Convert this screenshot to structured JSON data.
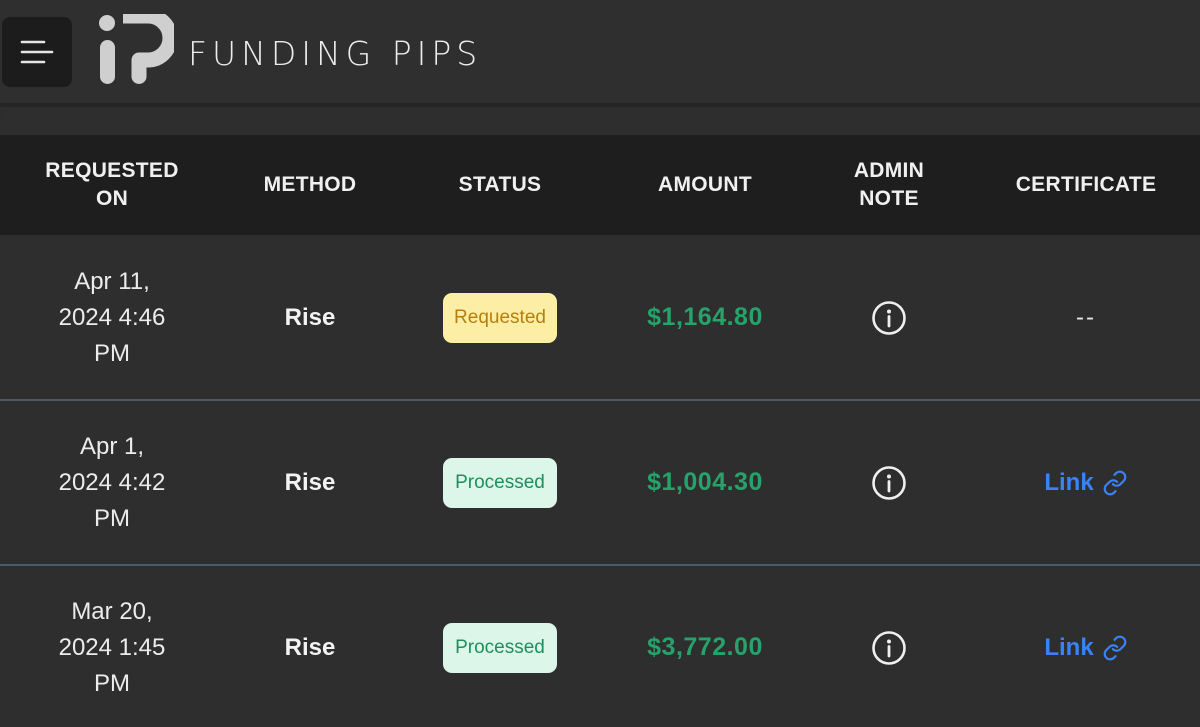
{
  "app": {
    "brand": "FUNDING PIPS"
  },
  "table": {
    "headers": {
      "requested_on_1": "REQUESTED",
      "requested_on_2": "ON",
      "method": "METHOD",
      "status": "STATUS",
      "amount": "AMOUNT",
      "admin_note_1": "ADMIN",
      "admin_note_2": "NOTE",
      "certificate": "CERTIFICATE"
    },
    "rows": [
      {
        "date_l1": "Apr 11,",
        "date_l2": "2024 4:46",
        "date_l3": "PM",
        "method": "Rise",
        "status": "Requested",
        "amount": "$1,164.80",
        "certificate": "--"
      },
      {
        "date_l1": "Apr 1,",
        "date_l2": "2024 4:42",
        "date_l3": "PM",
        "method": "Rise",
        "status": "Processed",
        "amount": "$1,004.30",
        "certificate": "Link"
      },
      {
        "date_l1": "Mar 20,",
        "date_l2": "2024 1:45",
        "date_l3": "PM",
        "method": "Rise",
        "status": "Processed",
        "amount": "$3,772.00",
        "certificate": "Link"
      }
    ]
  },
  "icons": {
    "menu": "hamburger-menu-icon",
    "logo": "funding-pips-logo",
    "admin_note": "info-circle-icon",
    "certificate_link": "chain-link-icon"
  },
  "colors": {
    "requested_bg": "#fdeea6",
    "requested_text": "#b67f0c",
    "processed_bg": "#dcf6ea",
    "processed_text": "#1f8f5c",
    "amount": "#25a36a",
    "link": "#3b82f6"
  }
}
